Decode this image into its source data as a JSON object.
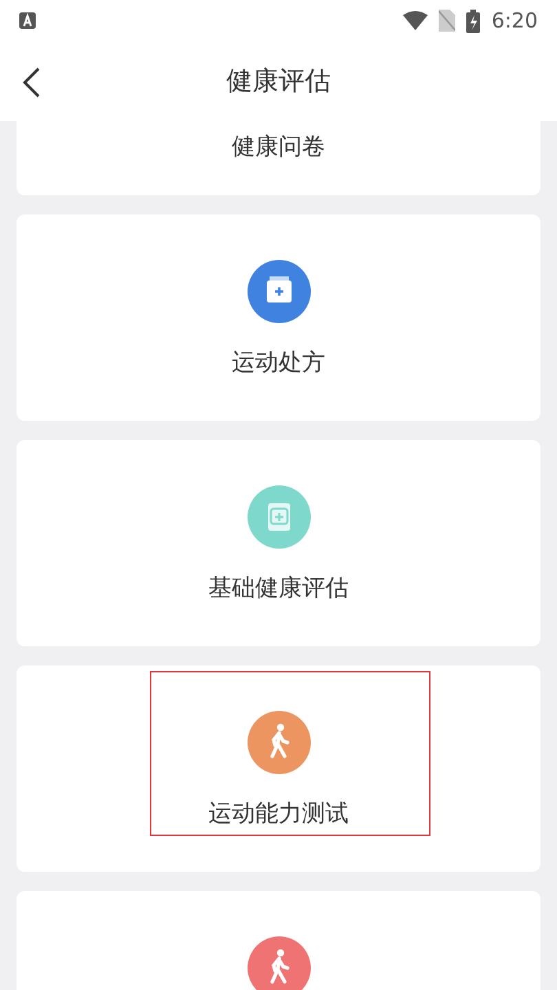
{
  "status_bar": {
    "time": "6:20"
  },
  "header": {
    "title": "健康评估"
  },
  "cards": [
    {
      "label": "健康问卷",
      "highlighted": false
    },
    {
      "label": "运动处方",
      "kind": "folder",
      "color": "#3f82e0",
      "highlighted": false
    },
    {
      "label": "基础健康评估",
      "kind": "document",
      "color": "#7fd8cc",
      "highlighted": false
    },
    {
      "label": "运动能力测试",
      "kind": "walker",
      "color": "#ec9560",
      "highlighted": true
    },
    {
      "kind": "walker",
      "color": "#ef7372",
      "highlighted": false
    }
  ]
}
